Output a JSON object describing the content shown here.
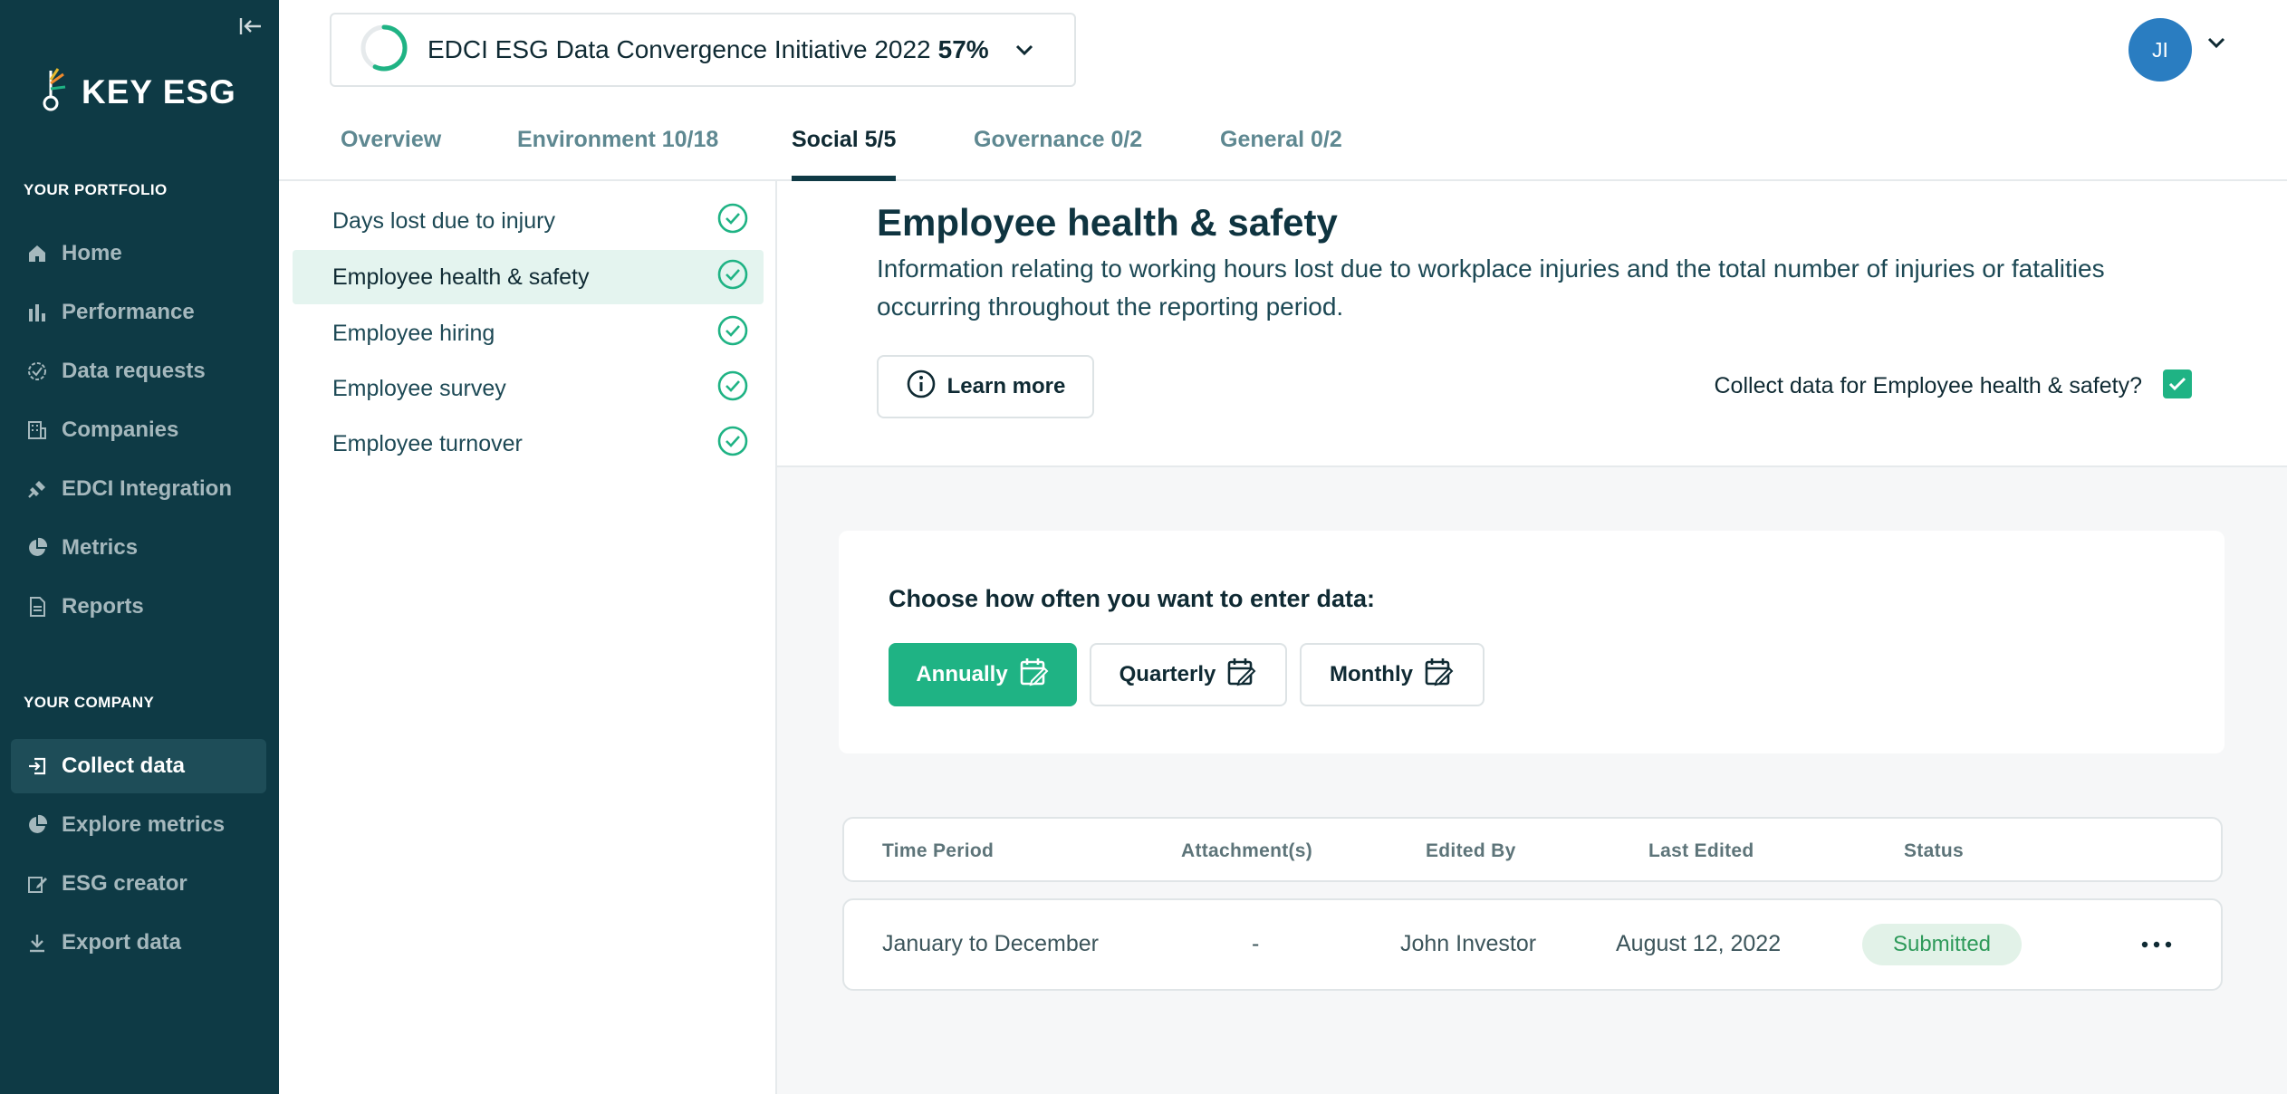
{
  "brand": {
    "name": "KEY ESG"
  },
  "sidebar": {
    "portfolio_title": "YOUR PORTFOLIO",
    "portfolio_items": [
      {
        "label": "Home",
        "icon": "home-icon"
      },
      {
        "label": "Performance",
        "icon": "bar-chart-icon"
      },
      {
        "label": "Data requests",
        "icon": "check-circle-icon"
      },
      {
        "label": "Companies",
        "icon": "building-icon"
      },
      {
        "label": "EDCI Integration",
        "icon": "plug-icon"
      },
      {
        "label": "Metrics",
        "icon": "pie-chart-icon"
      },
      {
        "label": "Reports",
        "icon": "document-icon"
      }
    ],
    "company_title": "YOUR COMPANY",
    "company_items": [
      {
        "label": "Collect data",
        "icon": "login-icon",
        "active": true
      },
      {
        "label": "Explore metrics",
        "icon": "pie-chart-icon"
      },
      {
        "label": "ESG creator",
        "icon": "edit-icon"
      },
      {
        "label": "Export data",
        "icon": "download-icon"
      }
    ]
  },
  "header": {
    "initiative_name": "EDCI ESG Data Convergence Initiative 2022",
    "initiative_progress_label": "57%",
    "initiative_progress": 0.57,
    "avatar_initials": "JI"
  },
  "tabs": [
    {
      "label": "Overview"
    },
    {
      "label": "Environment 10/18"
    },
    {
      "label": "Social 5/5",
      "active": true
    },
    {
      "label": "Governance 0/2"
    },
    {
      "label": "General 0/2"
    }
  ],
  "topics": [
    {
      "label": "Days lost due to injury",
      "done": true
    },
    {
      "label": "Employee health & safety",
      "done": true,
      "active": true
    },
    {
      "label": "Employee hiring",
      "done": true
    },
    {
      "label": "Employee survey",
      "done": true
    },
    {
      "label": "Employee turnover",
      "done": true
    }
  ],
  "section": {
    "title": "Employee health & safety",
    "description": "Information relating to working hours lost due to workplace injuries and the total number of injuries or fatalities occurring throughout the reporting period.",
    "learn_more": "Learn more",
    "collect_question": "Collect data for Employee health & safety?",
    "collect_checked": true
  },
  "frequency": {
    "title": "Choose how often you want to enter data:",
    "options": [
      {
        "label": "Annually",
        "active": true
      },
      {
        "label": "Quarterly"
      },
      {
        "label": "Monthly"
      }
    ]
  },
  "table": {
    "headers": [
      "Time Period",
      "Attachment(s)",
      "Edited By",
      "Last Edited",
      "Status"
    ],
    "rows": [
      {
        "period": "January to December",
        "attachments": "-",
        "edited_by": "John Investor",
        "last_edited": "August 12, 2022",
        "status": "Submitted"
      }
    ]
  },
  "colors": {
    "sidebar_bg": "#0e3a45",
    "accent_green": "#1fb384",
    "avatar_blue": "#2a7dc1",
    "status_green": "#2e9a5a"
  }
}
